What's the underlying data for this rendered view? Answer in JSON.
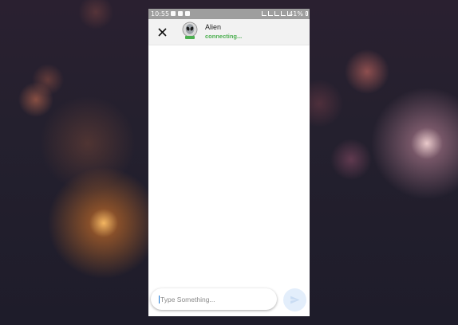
{
  "status_bar": {
    "time": "10:55",
    "battery": "41%"
  },
  "header": {
    "close_icon": "close-icon",
    "contact_name": "Alien",
    "contact_status": "connecting...",
    "status_color": "#4caf50"
  },
  "composer": {
    "placeholder": "Type Something...",
    "value": "",
    "send_icon": "send-icon"
  }
}
